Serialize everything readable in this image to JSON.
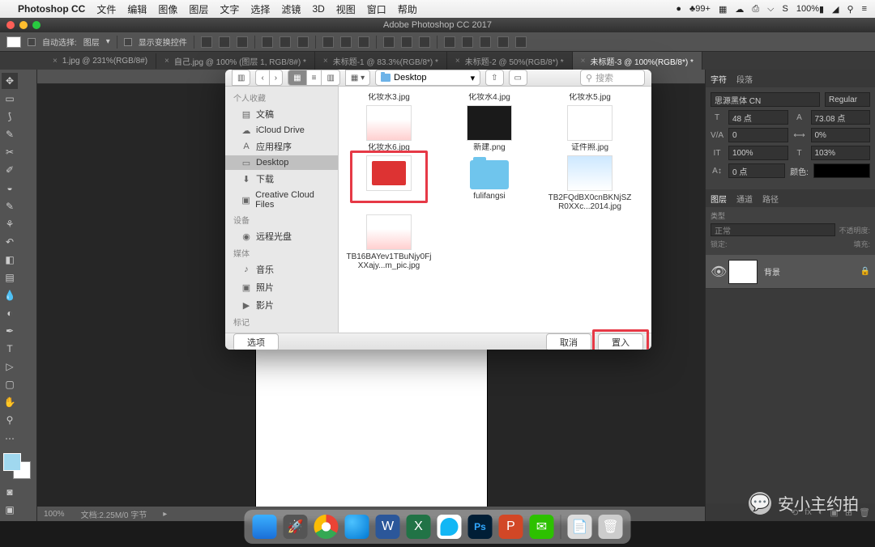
{
  "menubar": {
    "app": "Photoshop CC",
    "items": [
      "文件",
      "编辑",
      "图像",
      "图层",
      "文字",
      "选择",
      "滤镜",
      "3D",
      "视图",
      "窗口",
      "帮助"
    ],
    "right": {
      "badge": "99+",
      "battery": "100%"
    }
  },
  "window": {
    "title": "Adobe Photoshop CC 2017"
  },
  "options": {
    "auto_select": "自动选择:",
    "layer": "图层",
    "show_transform": "显示变换控件"
  },
  "tabs": [
    {
      "label": "1.jpg @ 231%(RGB/8#)",
      "active": false
    },
    {
      "label": "自己.jpg @ 100% (图层 1, RGB/8#) *",
      "active": false
    },
    {
      "label": "未标题-1 @ 83.3%(RGB/8*) *",
      "active": false
    },
    {
      "label": "未标题-2 @ 50%(RGB/8*) *",
      "active": false
    },
    {
      "label": "未标题-3 @ 100%(RGB/8*) *",
      "active": true
    }
  ],
  "status": {
    "zoom": "100%",
    "doc": "文档:2.25M/0 字节"
  },
  "char": {
    "tab1": "字符",
    "tab2": "段落",
    "font": "思源黑体 CN",
    "style": "Regular",
    "size": "48 点",
    "leading": "73.08 点",
    "tracking": "0",
    "kerning": "0%",
    "vscale": "100%",
    "hscale": "103%",
    "baseline": "0 点",
    "color": "颜色:"
  },
  "layers": {
    "tab1": "图层",
    "tab2": "通道",
    "tab3": "路径",
    "kind": "类型",
    "blend": "正常",
    "opacity_lbl": "不透明度:",
    "lock": "锁定:",
    "fill_lbl": "填充:",
    "bg_name": "背景"
  },
  "dialog": {
    "location": "Desktop",
    "search": "搜索",
    "sidebar": {
      "fav": "个人收藏",
      "items": [
        "文稿",
        "iCloud Drive",
        "应用程序",
        "Desktop",
        "下载",
        "Creative Cloud Files"
      ],
      "devices": "设备",
      "dev_item": "远程光盘",
      "media": "媒体",
      "media_items": [
        "音乐",
        "照片",
        "影片"
      ],
      "tags": "标记"
    },
    "files": [
      {
        "name": "化妆水3.jpg",
        "type": "none"
      },
      {
        "name": "化妆水4.jpg",
        "type": "none"
      },
      {
        "name": "化妆水5.jpg",
        "type": "none"
      },
      {
        "name": "化妆水6.jpg",
        "type": "photo1"
      },
      {
        "name": "新建.png",
        "type": "dark"
      },
      {
        "name": "证件照.jpg",
        "type": "grid"
      },
      {
        "name": "",
        "type": "child",
        "highlighted": true
      },
      {
        "name": "fulifangsi",
        "type": "folder"
      },
      {
        "name": "TB2FQdBX0cnBKNjSZR0XXc...2014.jpg",
        "type": "land"
      },
      {
        "name": "TB16BAYev1TBuNjy0FjXXajy...m_pic.jpg",
        "type": "photo1"
      }
    ],
    "options_btn": "选项",
    "cancel": "取消",
    "place": "置入"
  },
  "watermark": "安小主约拍",
  "ps_abbr": "Ps"
}
